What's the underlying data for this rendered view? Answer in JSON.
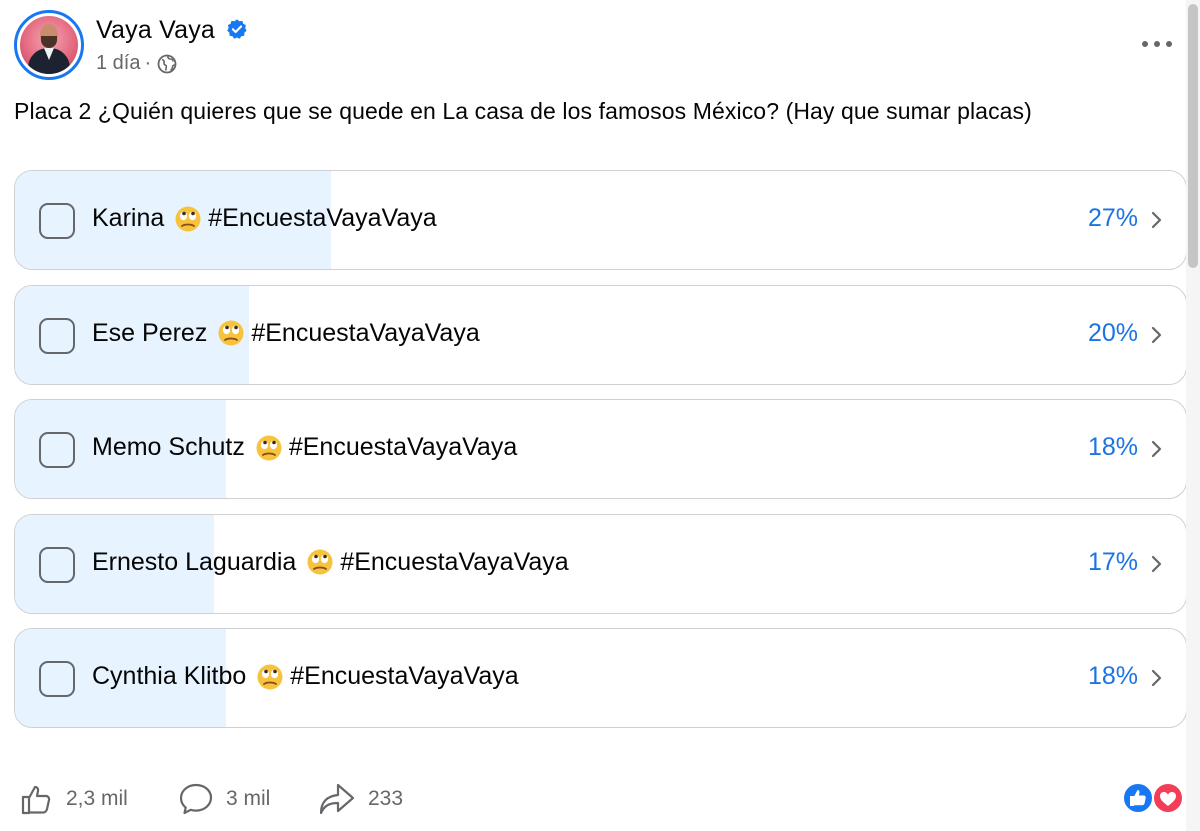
{
  "post": {
    "author": "Vaya Vaya",
    "time": "1 día",
    "dot": "·",
    "text": "Placa 2 ¿Quién quieres que se quede en La casa de los famosos México? (Hay que sumar placas)"
  },
  "poll": {
    "options": [
      {
        "name": "Karina",
        "hashtag": "#EncuestaVayaVaya",
        "percent_label": "27%",
        "percent": 27
      },
      {
        "name": "Ese Perez",
        "hashtag": "#EncuestaVayaVaya",
        "percent_label": "20%",
        "percent": 20
      },
      {
        "name": "Memo Schutz",
        "hashtag": "#EncuestaVayaVaya",
        "percent_label": "18%",
        "percent": 18
      },
      {
        "name": "Ernesto Laguardia",
        "hashtag": "#EncuestaVayaVaya",
        "percent_label": "17%",
        "percent": 17
      },
      {
        "name": "Cynthia Klitbo",
        "hashtag": "#EncuestaVayaVaya",
        "percent_label": "18%",
        "percent": 18
      }
    ]
  },
  "footer": {
    "likes": "2,3 mil",
    "comments": "3 mil",
    "shares": "233"
  },
  "icons": {
    "verified": "verified-badge-icon",
    "audience": "globe-icon",
    "more": "more-options-icon",
    "option_emoji": "face-with-rolling-eyes-icon",
    "like": "thumbs-up-icon",
    "comment": "speech-bubble-icon",
    "share": "share-arrow-icon",
    "reactions": [
      "like-reaction-icon",
      "love-reaction-icon"
    ]
  },
  "colors": {
    "accent": "#1b74e4",
    "bar_fill": "#e7f3ff",
    "border": "#ced0d4",
    "secondary_text": "#65676b",
    "love": "#f33e58"
  }
}
